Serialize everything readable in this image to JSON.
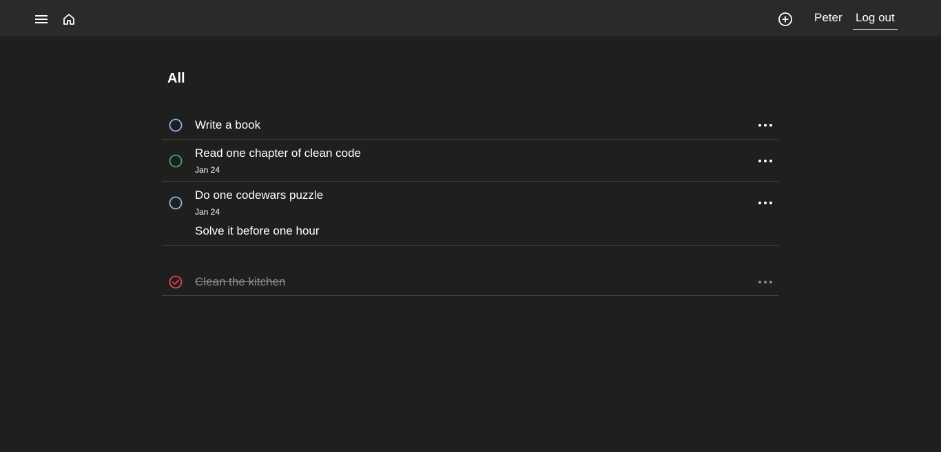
{
  "header": {
    "menu_icon": "hamburger-menu-icon",
    "home_icon": "home-icon",
    "add_icon": "plus-circle-icon",
    "user_name": "Peter",
    "logout_label": "Log out"
  },
  "page": {
    "title": "All"
  },
  "tasks": [
    {
      "title": "Write a book",
      "date": "",
      "description": "",
      "done": false,
      "color": "#8fb3e8"
    },
    {
      "title": "Read one chapter of clean code",
      "date": "Jan 24",
      "description": "",
      "done": false,
      "color": "#2fb35a"
    },
    {
      "title": "Do one codewars puzzle",
      "date": "Jan 24",
      "description": "Solve it before one hour",
      "done": false,
      "color": "#8fb3e8"
    }
  ],
  "completed_tasks": [
    {
      "title": "Clean the kitchen",
      "done": true,
      "color": "#e04848"
    }
  ],
  "colors": {
    "background": "#1f1f1f",
    "topbar": "#2a2a2a",
    "divider": "#3f3f3f"
  }
}
